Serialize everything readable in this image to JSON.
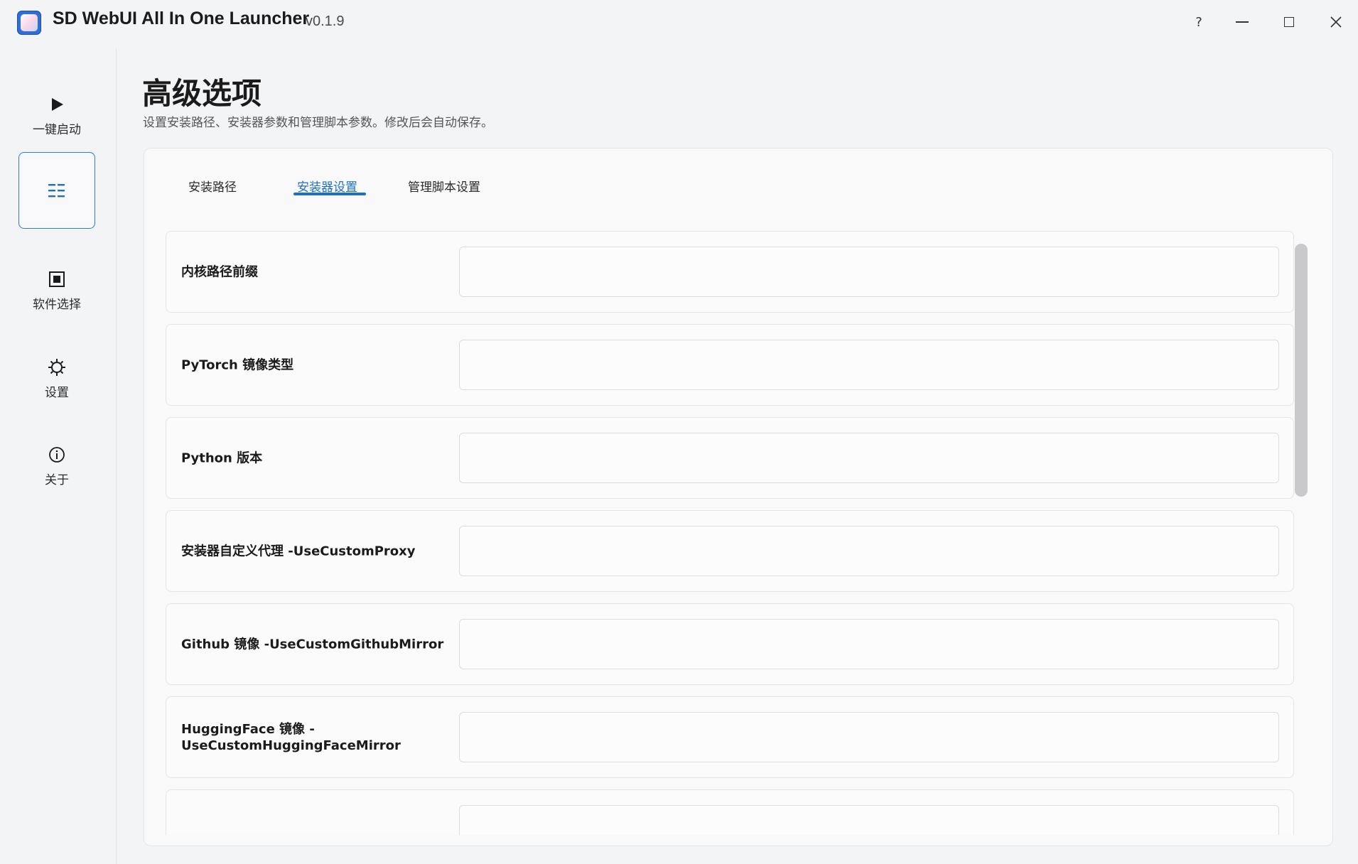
{
  "window": {
    "title": "SD WebUI All In One Launcher",
    "version": "v0.1.9",
    "help_label": "?"
  },
  "sidebar": {
    "items": [
      {
        "label": "一键启动",
        "icon": "play-icon"
      },
      {
        "label": "",
        "icon": "list-icon",
        "active": true
      },
      {
        "label": "软件选择",
        "icon": "square-select-icon"
      },
      {
        "label": "设置",
        "icon": "gear-icon"
      },
      {
        "label": "关于",
        "icon": "info-icon"
      }
    ]
  },
  "page": {
    "title": "高级选项",
    "subtitle": "设置安装路径、安装器参数和管理脚本参数。修改后会自动保存。"
  },
  "tabs": [
    {
      "label": "安装路径",
      "active": false
    },
    {
      "label": "安装器设置",
      "active": true
    },
    {
      "label": "管理脚本设置",
      "active": false
    }
  ],
  "rows": [
    {
      "label": "内核路径前缀",
      "value": ""
    },
    {
      "label": "PyTorch 镜像类型",
      "value": ""
    },
    {
      "label": "Python 版本",
      "value": ""
    },
    {
      "label": "安装器自定义代理 -UseCustomProxy",
      "value": ""
    },
    {
      "label": "Github 镜像 -UseCustomGithubMirror",
      "value": ""
    },
    {
      "label": "HuggingFace 镜像 -UseCustomHuggingFaceMirror",
      "value": ""
    },
    {
      "label": "",
      "value": ""
    }
  ],
  "colors": {
    "accent": "#1f6fc4",
    "background": "#f3f4f6",
    "card": "#f9f9fa"
  }
}
